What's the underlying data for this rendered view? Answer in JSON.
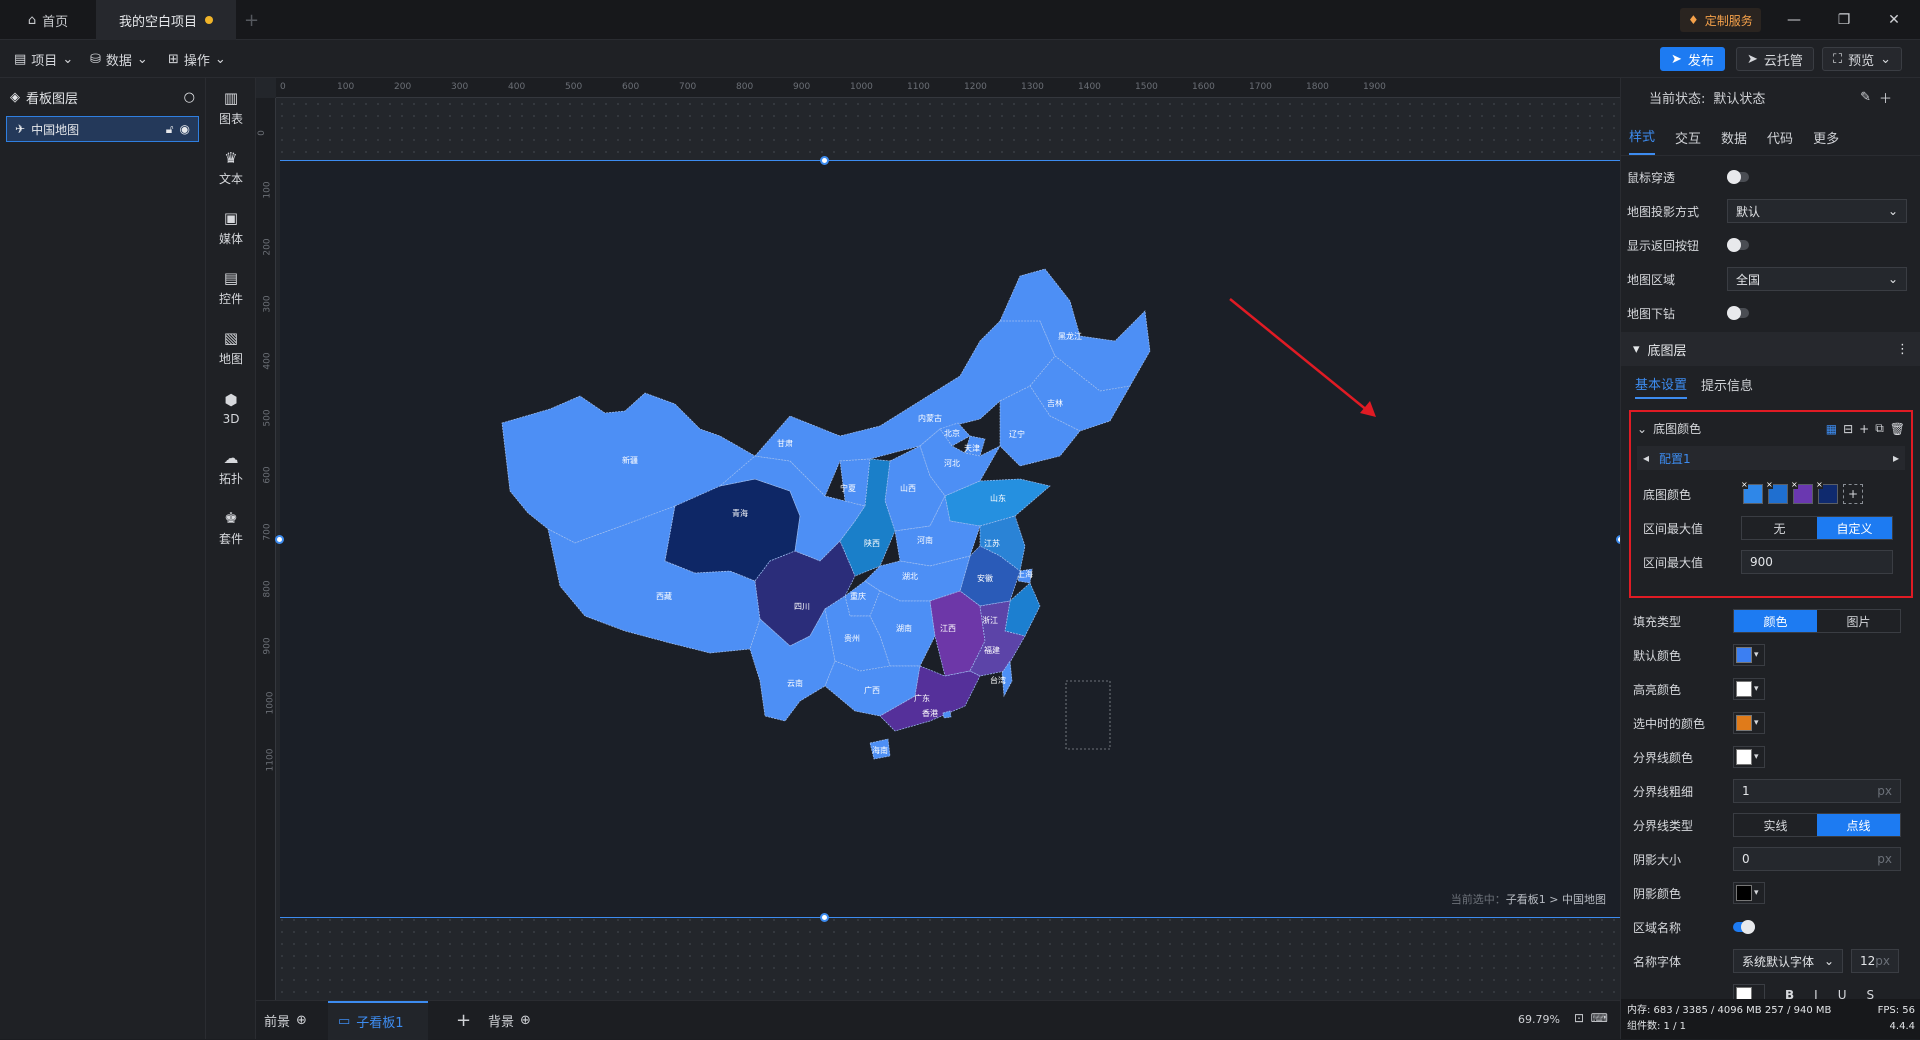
{
  "titlebar": {
    "home_tab": "首页",
    "project_tab": "我的空白项目",
    "custom_service": "定制服务"
  },
  "toolbar": {
    "menu_project": "项目",
    "menu_data": "数据",
    "menu_ops": "操作",
    "publish": "发布",
    "cloud_host": "云托管",
    "preview": "预览"
  },
  "layers": {
    "title": "看板图层",
    "items": [
      {
        "label": "中国地图"
      }
    ]
  },
  "components": [
    {
      "label": "图表",
      "icon": "chart-icon"
    },
    {
      "label": "文本",
      "icon": "text-icon"
    },
    {
      "label": "媒体",
      "icon": "media-icon"
    },
    {
      "label": "控件",
      "icon": "control-icon"
    },
    {
      "label": "地图",
      "icon": "map-icon"
    },
    {
      "label": "3D",
      "icon": "cube-icon"
    },
    {
      "label": "拓扑",
      "icon": "topology-icon"
    },
    {
      "label": "套件",
      "icon": "kit-icon"
    }
  ],
  "ruler": {
    "h_ticks": [
      "0",
      "100",
      "200",
      "300",
      "400",
      "500",
      "600",
      "700",
      "800",
      "900",
      "1000",
      "1100",
      "1200",
      "1300",
      "1400",
      "1500",
      "1600",
      "1700",
      "1800",
      "1900"
    ],
    "v_ticks": [
      "0",
      "100",
      "200",
      "300",
      "400",
      "500",
      "600",
      "700",
      "800",
      "900",
      "1000",
      "1100"
    ]
  },
  "map": {
    "provinces": [
      {
        "name": "新疆",
        "color": "#4d8ff5"
      },
      {
        "name": "西藏",
        "color": "#4d8ff5"
      },
      {
        "name": "青海",
        "color": "#0e2766"
      },
      {
        "name": "甘肃",
        "color": "#4d8ff5"
      },
      {
        "name": "内蒙古",
        "color": "#4d8ff5"
      },
      {
        "name": "黑龙江",
        "color": "#4d8ff5"
      },
      {
        "name": "吉林",
        "color": "#4d8ff5"
      },
      {
        "name": "辽宁",
        "color": "#4d8ff5"
      },
      {
        "name": "北京",
        "color": "#4d8ff5"
      },
      {
        "name": "天津",
        "color": "#4d8ff5"
      },
      {
        "name": "河北",
        "color": "#4d8ff5"
      },
      {
        "name": "山西",
        "color": "#4d8ff5"
      },
      {
        "name": "宁夏",
        "color": "#4d8ff5"
      },
      {
        "name": "陕西",
        "color": "#1a7fc9"
      },
      {
        "name": "山东",
        "color": "#2590e0"
      },
      {
        "name": "河南",
        "color": "#4d8ff5"
      },
      {
        "name": "江苏",
        "color": "#2a83d6"
      },
      {
        "name": "安徽",
        "color": "#2a5bb8"
      },
      {
        "name": "上海",
        "color": "#4d8ff5"
      },
      {
        "name": "四川",
        "color": "#2b2d7a"
      },
      {
        "name": "重庆",
        "color": "#4d8ff5"
      },
      {
        "name": "湖北",
        "color": "#4d8ff5"
      },
      {
        "name": "浙江",
        "color": "#1c7fd0"
      },
      {
        "name": "湖南",
        "color": "#4d8ff5"
      },
      {
        "name": "江西",
        "color": "#6d37a8"
      },
      {
        "name": "福建",
        "color": "#5c44a8"
      },
      {
        "name": "贵州",
        "color": "#4d8ff5"
      },
      {
        "name": "云南",
        "color": "#4d8ff5"
      },
      {
        "name": "广西",
        "color": "#4d8ff5"
      },
      {
        "name": "广东",
        "color": "#55309a"
      },
      {
        "name": "香港",
        "color": "#4d8ff5"
      },
      {
        "name": "台湾",
        "color": "#4d8ff5"
      },
      {
        "name": "海南",
        "color": "#4d8ff5"
      }
    ]
  },
  "canvas": {
    "crumb_prefix": "当前选中：",
    "crumb_path": "子看板1 > 中国地图"
  },
  "bottom": {
    "foreground": "前景",
    "board_tab": "子看板1",
    "background": "背景",
    "zoom": "69.79%"
  },
  "panel": {
    "state_label": "当前状态:",
    "state_value": "默认状态",
    "tabs": [
      "样式",
      "交互",
      "数据",
      "代码",
      "更多"
    ],
    "rows": {
      "mouse_through": "鼠标穿透",
      "projection": "地图投影方式",
      "projection_value": "默认",
      "show_back": "显示返回按钮",
      "region": "地图区域",
      "region_value": "全国",
      "drilldown": "地图下钻"
    },
    "base_layer": "底图层",
    "subtabs": [
      "基本设置",
      "提示信息"
    ],
    "base_color_section": "底图颜色",
    "config_tab": "配置1",
    "base_color_label": "底图颜色",
    "swatches": [
      "#2f87e8",
      "#1f6fd0",
      "#6a38b0",
      "#0f2a6e"
    ],
    "max_label_1": "区间最大值",
    "max_seg": [
      "无",
      "自定义"
    ],
    "max_label_2": "区间最大值",
    "max_value": "900",
    "fill_type": "填充类型",
    "fill_seg": [
      "颜色",
      "图片"
    ],
    "default_color": "默认颜色",
    "default_color_hex": "#3c7ff2",
    "highlight_color": "高亮颜色",
    "highlight_color_hex": "#ffffff",
    "selected_color": "选中时的颜色",
    "selected_color_hex": "#e07b1a",
    "border_color": "分界线颜色",
    "border_color_hex": "#ffffff",
    "border_width": "分界线粗细",
    "border_width_value": "1",
    "border_type": "分界线类型",
    "border_seg": [
      "实线",
      "点线"
    ],
    "shadow_size": "阴影大小",
    "shadow_value": "0",
    "shadow_color": "阴影颜色",
    "shadow_color_hex": "#000000",
    "region_name": "区域名称",
    "name_font": "名称字体",
    "font_value": "系统默认字体",
    "font_size": "12",
    "unit_px": "px",
    "text_color_hex": "#ffffff"
  },
  "status": {
    "memory": "内存:  683 / 3385 / 4096 MB  257 / 940 MB",
    "fps": "FPS:  56",
    "components": "组件数: 1 / 1",
    "version": "4.4.4"
  }
}
